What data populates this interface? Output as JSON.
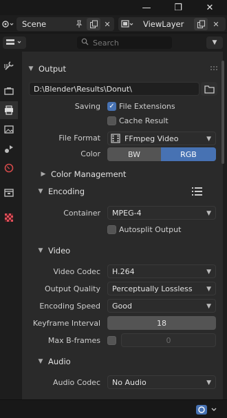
{
  "window": {
    "minimize_glyph": "—",
    "maximize_glyph": "❐",
    "close_glyph": "✕"
  },
  "topbar": {
    "scene_name": "Scene",
    "viewlayer_name": "ViewLayer"
  },
  "search": {
    "placeholder": "Search"
  },
  "output": {
    "title": "Output",
    "path": "D:\\Blender\\Results\\Donut\\",
    "saving_label": "Saving",
    "file_extensions_label": "File Extensions",
    "file_extensions_checked": true,
    "cache_result_label": "Cache Result",
    "cache_result_checked": false,
    "file_format_label": "File Format",
    "file_format_value": "FFmpeg Video",
    "color_label": "Color",
    "color_options": [
      "BW",
      "RGB"
    ],
    "color_selected": "RGB",
    "color_management_label": "Color Management"
  },
  "encoding": {
    "title": "Encoding",
    "container_label": "Container",
    "container_value": "MPEG-4",
    "autosplit_label": "Autosplit Output",
    "autosplit_checked": false
  },
  "video": {
    "title": "Video",
    "codec_label": "Video Codec",
    "codec_value": "H.264",
    "quality_label": "Output Quality",
    "quality_value": "Perceptually Lossless",
    "speed_label": "Encoding Speed",
    "speed_value": "Good",
    "keyframe_label": "Keyframe Interval",
    "keyframe_value": "18",
    "max_bframes_label": "Max B-frames",
    "max_bframes_checked": false,
    "max_bframes_value": "0"
  },
  "audio": {
    "title": "Audio",
    "codec_label": "Audio Codec",
    "codec_value": "No Audio"
  },
  "colors": {
    "accent": "#4772b3",
    "panel_bg": "#2a2a2a",
    "window_bg": "#181818"
  }
}
